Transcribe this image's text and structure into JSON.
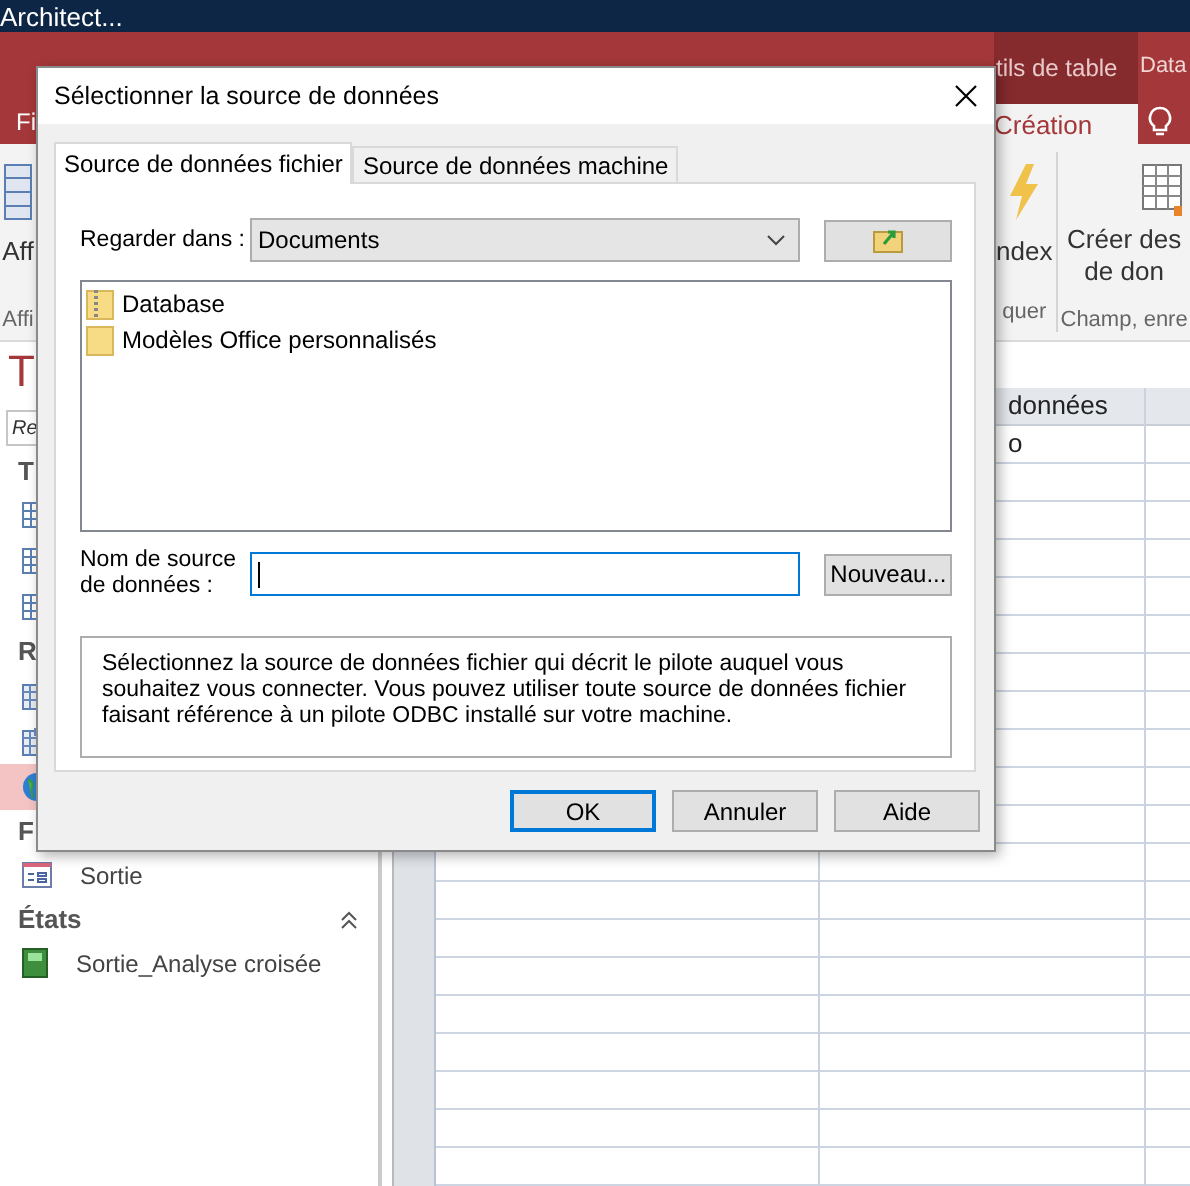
{
  "app_title": "Architect...",
  "ribbon": {
    "tabs": [
      {
        "label": "Fi",
        "selected": false
      }
    ],
    "contextual": {
      "title": "tils de table",
      "tabs": [
        {
          "label": "Création",
          "selected": true
        }
      ]
    },
    "extra_tab": {
      "label": "Data",
      "selected": false
    },
    "groups": [
      {
        "kind": "view",
        "lines": [
          "Aff"
        ],
        "label": "Affi"
      },
      {
        "kind": "index",
        "lines": [
          "ndex"
        ],
        "label": "quer"
      },
      {
        "kind": "create",
        "lines": [
          "Créer des",
          "de don"
        ],
        "label": "Champ, enre"
      }
    ]
  },
  "nav": {
    "title": "T",
    "search": {
      "placeholder": "Re"
    },
    "sections": [
      {
        "title": "T",
        "collapsible": false,
        "items": [
          {
            "kind": "table",
            "selected": false
          },
          {
            "kind": "table",
            "selected": false
          },
          {
            "kind": "table",
            "selected": false
          }
        ]
      },
      {
        "title": "R",
        "collapsible": false,
        "items": [
          {
            "kind": "query",
            "selected": false
          },
          {
            "kind": "query2",
            "selected": false
          },
          {
            "kind": "globe",
            "selected": true
          }
        ]
      },
      {
        "title": "F",
        "collapsible": false,
        "items": [
          {
            "kind": "form",
            "label": "Sortie",
            "selected": false
          }
        ]
      },
      {
        "title": "États",
        "collapsible": true,
        "items": [
          {
            "kind": "report",
            "label": "Sortie_Analyse croisée",
            "selected": false
          }
        ]
      }
    ]
  },
  "table": {
    "column_2": {
      "header": "données",
      "cells": [
        "o"
      ]
    }
  },
  "dialog": {
    "title": "Sélectionner la source de données",
    "tabs": [
      {
        "label": "Source de données fichier",
        "selected": true
      },
      {
        "label": "Source de données machine",
        "selected": false
      }
    ],
    "look_in": {
      "label": "Regarder dans :",
      "value": "Documents"
    },
    "files": [
      {
        "kind": "zip",
        "name": "Database"
      },
      {
        "kind": "folder",
        "name": "Modèles Office personnalisés"
      }
    ],
    "name_field": {
      "label": "Nom de source de données :",
      "focused": true
    },
    "new_button": "Nouveau...",
    "description": "Sélectionnez la source de données fichier qui décrit le pilote auquel vous souhaitez vous connecter. Vous pouvez utiliser toute source de données fichier faisant référence à un pilote ODBC installé sur votre machine.",
    "buttons": [
      {
        "label": "OK",
        "default": true
      },
      {
        "label": "Annuler",
        "default": false
      },
      {
        "label": "Aide",
        "default": false
      }
    ]
  }
}
